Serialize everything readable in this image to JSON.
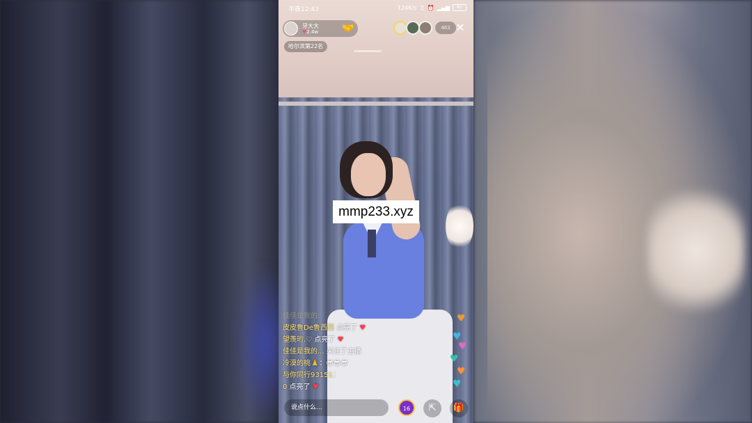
{
  "status_bar": {
    "time": "半夜12:43",
    "network_speed": "124K/s",
    "battery": "81"
  },
  "host": {
    "name": "牙大大",
    "likes": "2.4w",
    "follow_icon": "handshake-icon"
  },
  "rank_badge": "哈尔滨第22名",
  "viewer_count": "463",
  "watermark": "mmp233.xyz",
  "chat": [
    {
      "user": "佳佳是我的:",
      "text": "",
      "faded": true
    },
    {
      "user": "皮皮鲁De鲁西西",
      "text": " 点亮了 ",
      "icon": "♥"
    },
    {
      "user": "望羡珩.♡",
      "text": " 点亮了 ",
      "icon": "♥"
    },
    {
      "user": "佳佳是我的...",
      "text": " 关注了主播",
      "icon": ""
    },
    {
      "user": "冷漠的桃🙏",
      "text": "：😎😎😎",
      "icon": ""
    },
    {
      "user": "与你同行93151",
      "text": "：",
      "icon": ""
    },
    {
      "user": "0",
      "text": " 点亮了 ",
      "icon": "♥"
    }
  ],
  "bottom": {
    "placeholder": "说点什么...",
    "fan_level": "16"
  },
  "colors": {
    "chat_user": "#ffe27a",
    "heart": "#ff3b4d",
    "follow": "#ffbf1f"
  }
}
